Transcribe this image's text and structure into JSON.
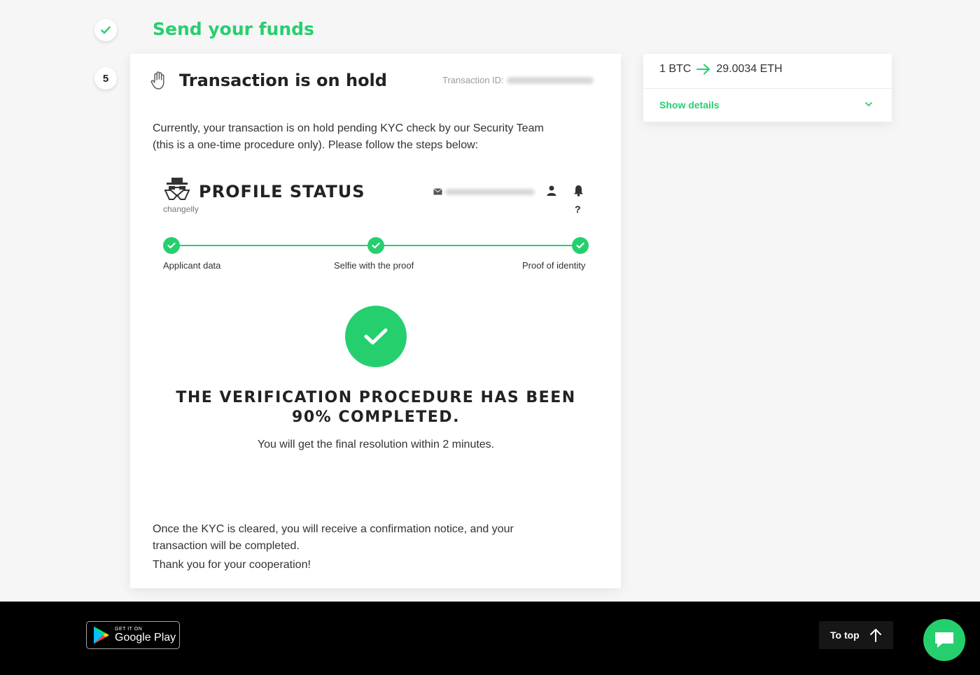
{
  "colors": {
    "accent": "#26cf6e",
    "footer_bg": "#000000",
    "page_bg": "#f6f6f6"
  },
  "steps": {
    "done_icon": "check-icon",
    "send_title": "Send your funds",
    "current_number": "5"
  },
  "card": {
    "title": "Transaction is on hold",
    "title_icon": "hand-icon",
    "transaction_id_label": "Transaction ID:",
    "intro": "Currently, your transaction is on hold pending KYC check by our Security Team (this is a one-time procedure only). Please follow the steps below:",
    "profile": {
      "title": "PROFILE STATUS",
      "brand": "changelly",
      "help": "?",
      "steps": [
        "Applicant data",
        "Selfie with the proof",
        "Proof of identity"
      ]
    },
    "verification": {
      "title_line1": "THE VERIFICATION PROCEDURE HAS BEEN",
      "title_line2": "90% COMPLETED.",
      "subtitle": "You will get the final resolution within 2 minutes."
    },
    "outro": "Once the KYC is cleared, you will receive a confirmation notice, and your transaction will be completed.",
    "thanks": "Thank you for your cooperation!"
  },
  "side": {
    "from": "1 BTC",
    "to": "29.0034 ETH",
    "show_details": "Show details"
  },
  "footer": {
    "gplay_small": "GET IT ON",
    "gplay_big": "Google Play",
    "to_top": "To top"
  }
}
